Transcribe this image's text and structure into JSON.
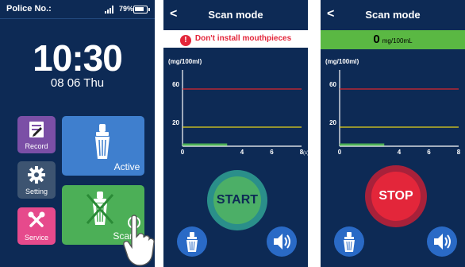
{
  "home": {
    "status": {
      "label": "Police No.:",
      "battery": "79%"
    },
    "time": "10:30",
    "date": "08 06 Thu",
    "tiles": {
      "record": "Record",
      "setting": "Setting",
      "service": "Service",
      "active": "Active",
      "scan": "Scan"
    }
  },
  "scan_ready": {
    "title": "Scan mode",
    "warning": "Don't install mouthpieces",
    "start_label": "START"
  },
  "scan_running": {
    "title": "Scan mode",
    "reading_value": "0",
    "reading_unit": "mg/100mL",
    "stop_label": "STOP"
  },
  "chart_data": [
    {
      "type": "line",
      "ylabel": "(mg/100ml)",
      "xunit": "(s)",
      "x_ticks": [
        "0",
        "4",
        "6",
        "8"
      ],
      "y_ticks": [
        "20",
        "60"
      ],
      "xlim": [
        0,
        8
      ],
      "ylim": [
        0,
        80
      ],
      "threshold_lines": [
        {
          "value": 60,
          "color": "#d9282f"
        },
        {
          "value": 20,
          "color": "#e6d21a"
        }
      ],
      "series": [
        {
          "x": [
            0,
            3
          ],
          "values": [
            0,
            0
          ],
          "color": "#4caf57"
        }
      ]
    },
    {
      "type": "line",
      "ylabel": "(mg/100ml)",
      "xunit": "",
      "x_ticks": [
        "0",
        "4",
        "6",
        "8"
      ],
      "y_ticks": [
        "20",
        "60"
      ],
      "xlim": [
        0,
        8
      ],
      "ylim": [
        0,
        80
      ],
      "threshold_lines": [
        {
          "value": 60,
          "color": "#d9282f"
        },
        {
          "value": 20,
          "color": "#e6d21a"
        }
      ],
      "series": [
        {
          "x": [
            0,
            3
          ],
          "values": [
            0,
            0
          ],
          "color": "#4caf57"
        }
      ]
    }
  ]
}
